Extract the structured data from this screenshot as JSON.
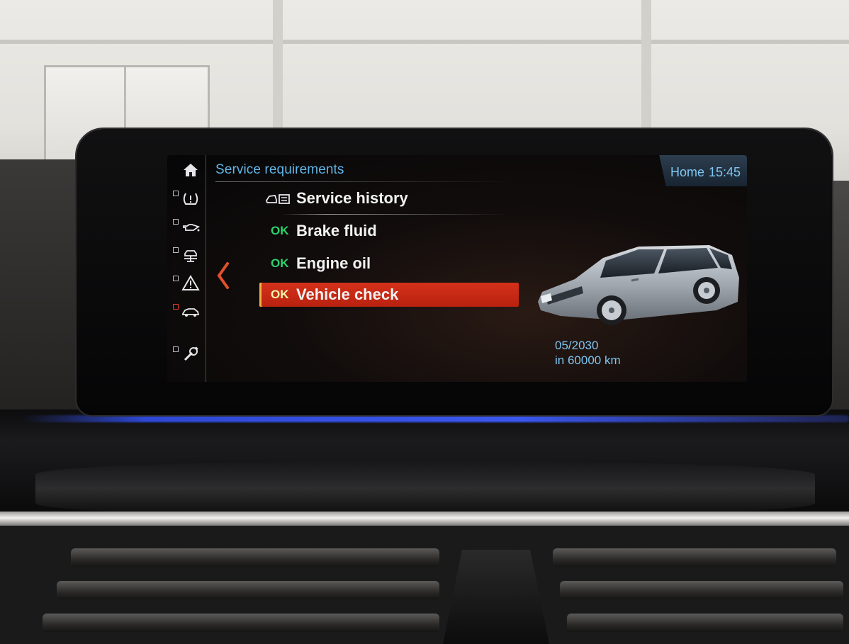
{
  "header": {
    "title": "Service requirements",
    "home_label": "Home",
    "time": "15:45"
  },
  "sidebar": {
    "items": [
      {
        "icon": "home-icon"
      },
      {
        "icon": "tire-pressure-icon"
      },
      {
        "icon": "oil-can-icon"
      },
      {
        "icon": "vehicle-lift-icon"
      },
      {
        "icon": "warning-triangle-icon"
      },
      {
        "icon": "car-status-icon"
      },
      {
        "icon": "wrench-icon"
      }
    ]
  },
  "menu": {
    "items": [
      {
        "status": "",
        "label": "Service history",
        "icon": "service-history-icon"
      },
      {
        "status": "OK",
        "label": "Brake fluid"
      },
      {
        "status": "OK",
        "label": "Engine oil"
      },
      {
        "status": "OK",
        "label": "Vehicle check",
        "selected": true
      }
    ]
  },
  "service_due": {
    "date": "05/2030",
    "distance": "in 60000 km"
  },
  "colors": {
    "accent_blue": "#62b6e8",
    "ok_green": "#2dd16b",
    "selection_red": "#c8280f"
  }
}
